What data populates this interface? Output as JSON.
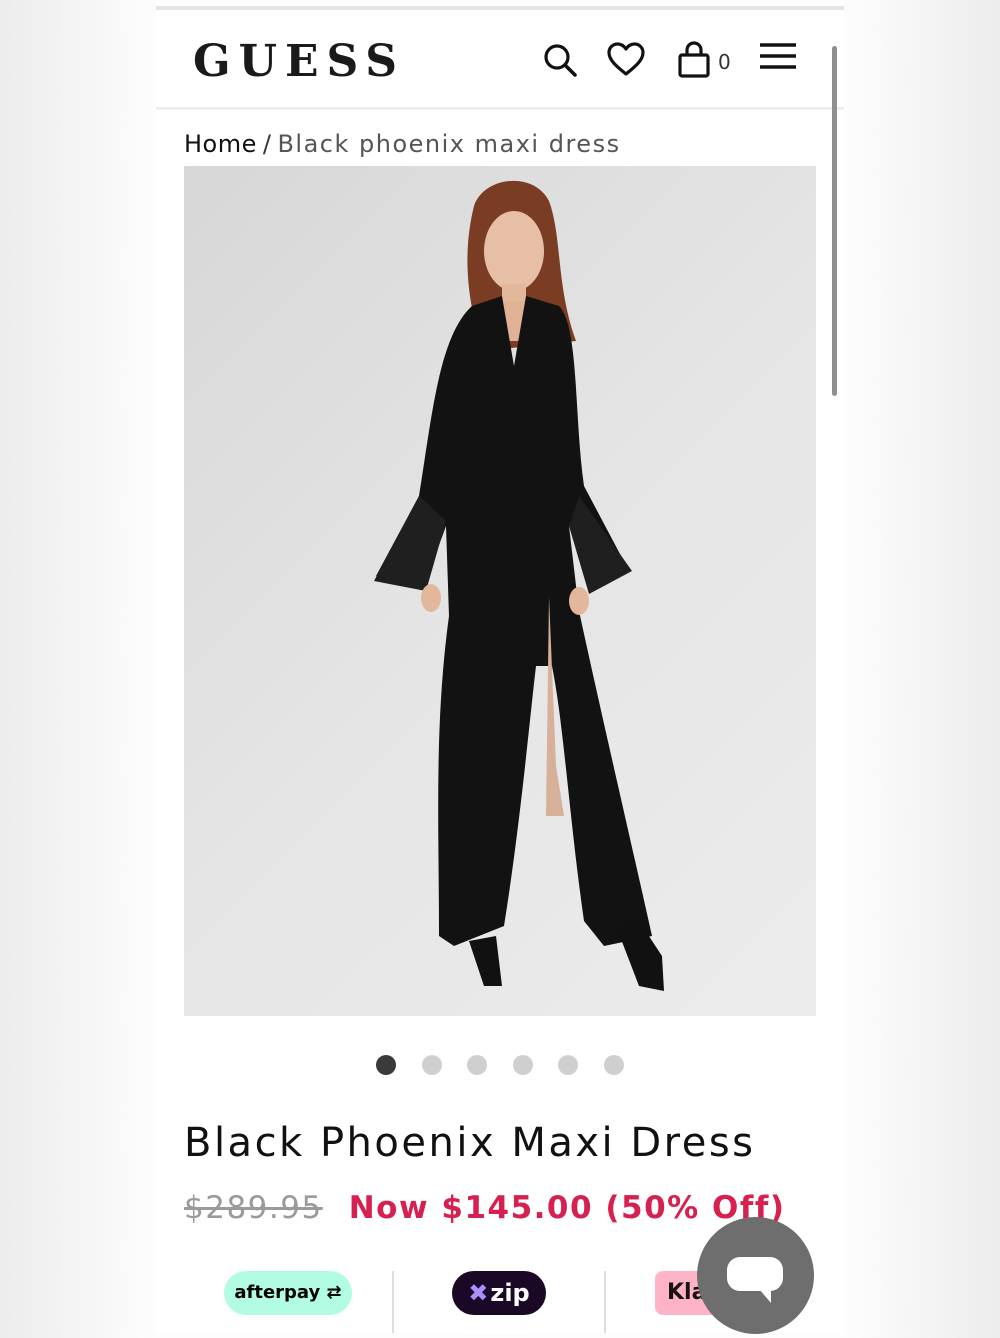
{
  "header": {
    "logo": "GUESS",
    "icons": [
      "search-icon",
      "heart-icon",
      "shopping-bag-icon",
      "hamburger-menu-icon"
    ],
    "bag_count": "0"
  },
  "breadcrumb": {
    "home": "Home",
    "separator": "/",
    "current": "Black phoenix maxi dress"
  },
  "gallery": {
    "slide_count": 6,
    "active_index": 0
  },
  "product": {
    "title": "Black Phoenix Maxi Dress",
    "original_price": "$289.95",
    "sale_price": "Now $145.00 (50% Off)"
  },
  "payment_options": {
    "afterpay": "afterpay",
    "zip": "zip",
    "klarna": "Kla"
  },
  "colors": {
    "sale": "#d6204f",
    "afterpay_bg": "#b2fce4",
    "zip_bg": "#1a0826",
    "klarna_bg": "#ffb3c7",
    "chat_bg": "#6e6e6e"
  }
}
